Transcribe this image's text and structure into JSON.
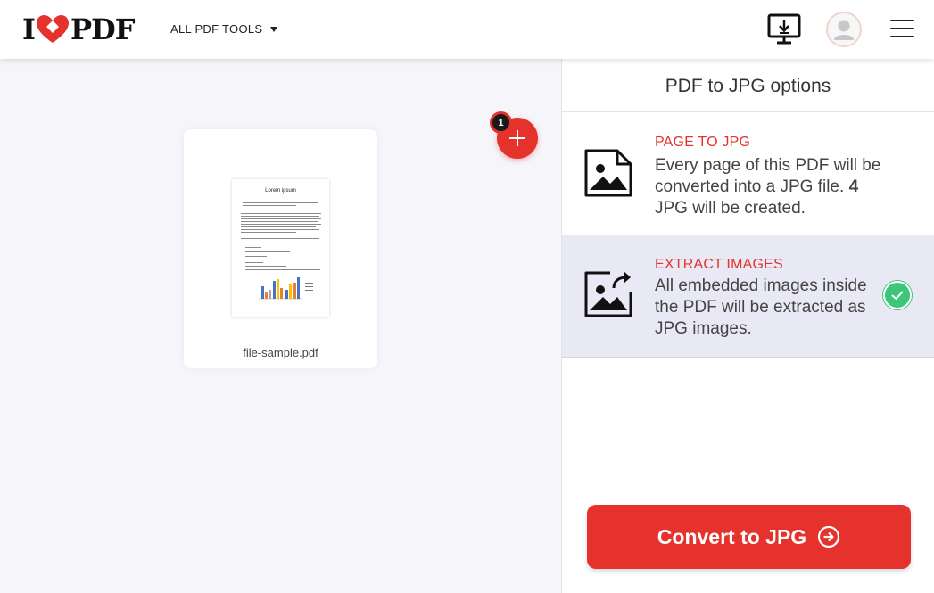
{
  "header": {
    "logo_left": "I",
    "logo_right": "PDF",
    "tools_menu_label": "ALL PDF TOOLS"
  },
  "workspace": {
    "file_name": "file-sample.pdf",
    "file_count_badge": "1",
    "thumbnail_title": "Lorem ipsum"
  },
  "sidebar": {
    "title": "PDF to JPG options",
    "options": [
      {
        "title": "PAGE TO JPG",
        "desc_before": "Every page of this PDF will be converted into a JPG file. ",
        "desc_count": "4",
        "desc_after": " JPG will be created.",
        "selected": false
      },
      {
        "title": "EXTRACT IMAGES",
        "desc": "All embedded images inside the PDF will be extracted as JPG images.",
        "selected": true
      }
    ],
    "convert_label": "Convert to JPG"
  },
  "colors": {
    "brand_red": "#e5322d",
    "selected_bg": "#e9e9f5",
    "check_green": "#3dc67a"
  },
  "icons": [
    "heart-logo-icon",
    "desktop-download-icon",
    "user-avatar-icon",
    "hamburger-menu-icon",
    "plus-icon",
    "image-file-icon",
    "image-share-icon",
    "checkmark-icon",
    "arrow-right-circle-icon"
  ]
}
